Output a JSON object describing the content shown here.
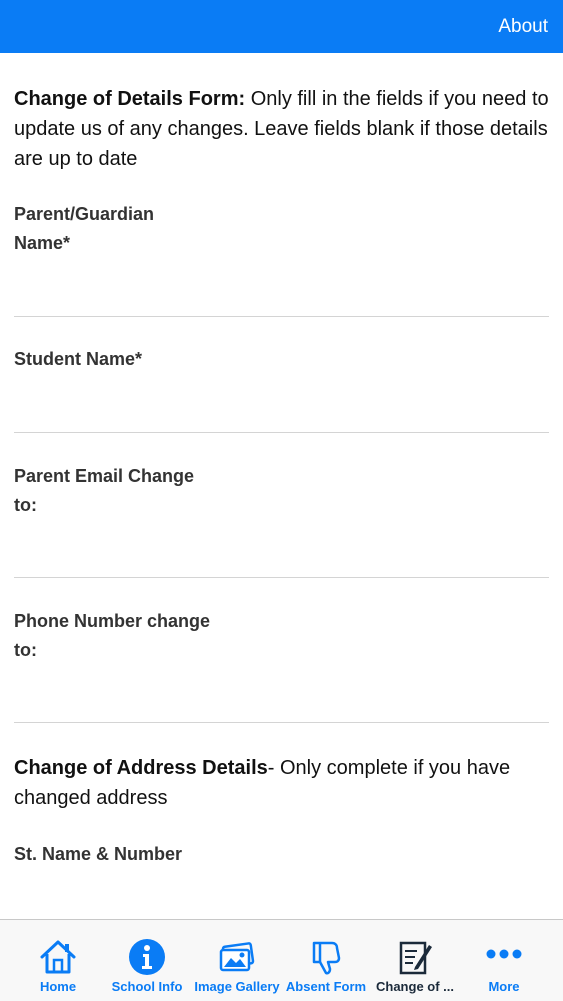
{
  "header": {
    "about_label": "About"
  },
  "intro": {
    "bold": "Change of Details Form:",
    "text": " Only fill in the fields if you need to update us of any changes. Leave fields blank if those details are up to date"
  },
  "fields": [
    {
      "label": "Parent/Guardian Name*",
      "value": ""
    },
    {
      "label": "Student Name*",
      "value": ""
    },
    {
      "label": "Parent Email Change to:",
      "value": ""
    },
    {
      "label": "Phone Number change to:",
      "value": ""
    },
    {
      "label": "St. Name & Number",
      "value": ""
    }
  ],
  "address_section": {
    "bold": "Change of Address Details",
    "text": "- Only complete if you have changed address"
  },
  "tabs": [
    {
      "label": "Home",
      "icon": "home-icon"
    },
    {
      "label": "School Info",
      "icon": "info-icon"
    },
    {
      "label": "Image Gallery",
      "icon": "gallery-icon"
    },
    {
      "label": "Absent Form",
      "icon": "thumbs-down-icon"
    },
    {
      "label": "Change of ...",
      "icon": "edit-form-icon",
      "active": true
    },
    {
      "label": "More",
      "icon": "more-icon"
    }
  ],
  "colors": {
    "accent": "#0a7cf5",
    "active_tab": "#1b2a3a"
  }
}
